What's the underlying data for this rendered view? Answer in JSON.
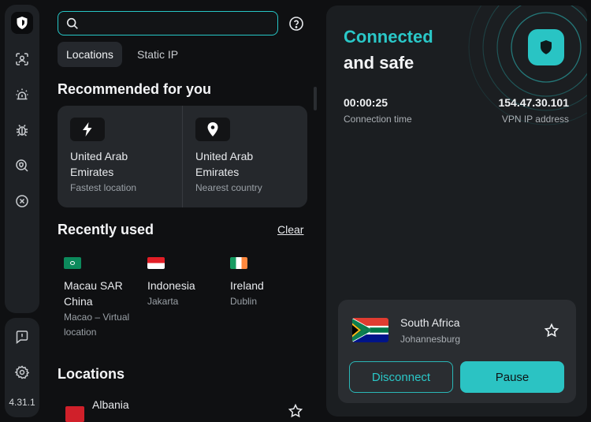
{
  "app": {
    "version": "4.31.1"
  },
  "search": {
    "value": "",
    "placeholder": ""
  },
  "tabs": [
    {
      "label": "Locations",
      "active": true
    },
    {
      "label": "Static IP",
      "active": false
    }
  ],
  "recommended": {
    "title": "Recommended for you",
    "cards": [
      {
        "icon": "bolt-icon",
        "name": "United Arab Emirates",
        "subtitle": "Fastest location"
      },
      {
        "icon": "location-pin-icon",
        "name": "United Arab Emirates",
        "subtitle": "Nearest country"
      }
    ]
  },
  "recently_used": {
    "title": "Recently used",
    "clear_label": "Clear",
    "items": [
      {
        "name": "Macau SAR China",
        "subtitle": "Macao – Virtual location"
      },
      {
        "name": "Indonesia",
        "subtitle": "Jakarta"
      },
      {
        "name": "Ireland",
        "subtitle": "Dublin"
      }
    ]
  },
  "locations": {
    "title": "Locations",
    "items": [
      {
        "name": "Albania"
      }
    ]
  },
  "connection": {
    "status_line1": "Connected",
    "status_line2": "and safe",
    "time_value": "00:00:25",
    "time_label": "Connection time",
    "ip_value": "154.47.30.101",
    "ip_label": "VPN IP address",
    "country": "South Africa",
    "city": "Johannesburg",
    "disconnect_label": "Disconnect",
    "pause_label": "Pause"
  },
  "colors": {
    "accent": "#2bc3c3",
    "background": "#0f1012",
    "panel": "#1b1e21"
  }
}
